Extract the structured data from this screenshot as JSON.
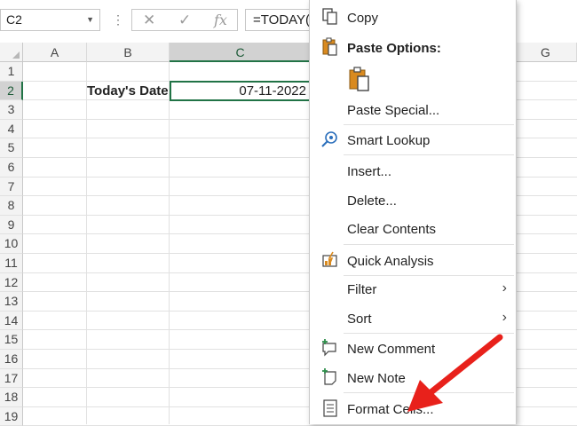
{
  "formula_bar": {
    "name_box": "C2",
    "formula": "=TODAY()",
    "fx_label": "fx",
    "cancel_icon": "✕",
    "enter_icon": "✓"
  },
  "columns": [
    "A",
    "B",
    "C",
    "G"
  ],
  "rows": [
    "1",
    "2",
    "3",
    "4",
    "5",
    "6",
    "7",
    "8",
    "9",
    "10",
    "11",
    "12",
    "13",
    "14",
    "15",
    "16",
    "17",
    "18",
    "19"
  ],
  "cells": {
    "B2": "Today's Date",
    "C2": "07-11-2022"
  },
  "context_menu": {
    "copy": "Copy",
    "paste_options": "Paste Options:",
    "paste_special": "Paste Special...",
    "smart_lookup": "Smart Lookup",
    "insert": "Insert...",
    "delete": "Delete...",
    "clear_contents": "Clear Contents",
    "quick_analysis": "Quick Analysis",
    "filter": "Filter",
    "sort": "Sort",
    "new_comment": "New Comment",
    "new_note": "New Note",
    "format_cells": "Format Cells..."
  },
  "colors": {
    "excel_green": "#217346",
    "arrow_red": "#e8211b",
    "icon_orange": "#d98a1f",
    "icon_green": "#2f8f4c",
    "icon_blue": "#2a6ebb"
  },
  "icons": [
    "copy-icon",
    "paste-icon",
    "paste-clipboard-icon",
    "smart-lookup-icon",
    "quick-analysis-icon",
    "new-comment-icon",
    "new-note-icon",
    "format-cells-icon",
    "chevron-right-icon"
  ]
}
